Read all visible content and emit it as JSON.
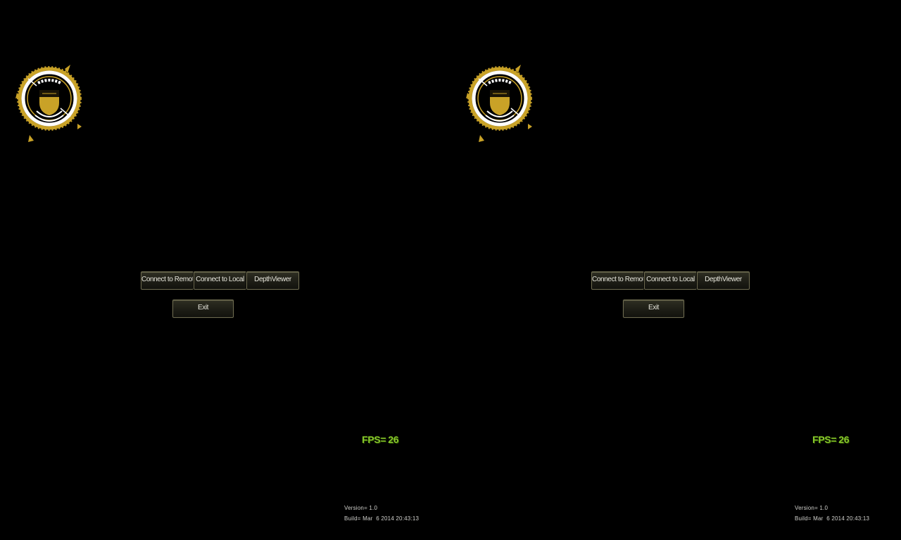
{
  "screen": {
    "buttons": {
      "connect_remote": "Connect to Remote",
      "connect_local": "Connect to Local",
      "depth_viewer": "DepthViewer",
      "exit": "Exit"
    },
    "fps": {
      "label": "FPS=",
      "value": "26"
    },
    "version": "Version= 1.0",
    "build": "Build= Mar  6 2014 20:43:13"
  },
  "colors": {
    "background": "#000000",
    "logo_gold": "#c9a227",
    "logo_white": "#ffffff",
    "fps_green": "#86c62b",
    "button_border": "#6e6b50"
  },
  "icons": {
    "logo": "circular-hud-emblem-icon"
  }
}
